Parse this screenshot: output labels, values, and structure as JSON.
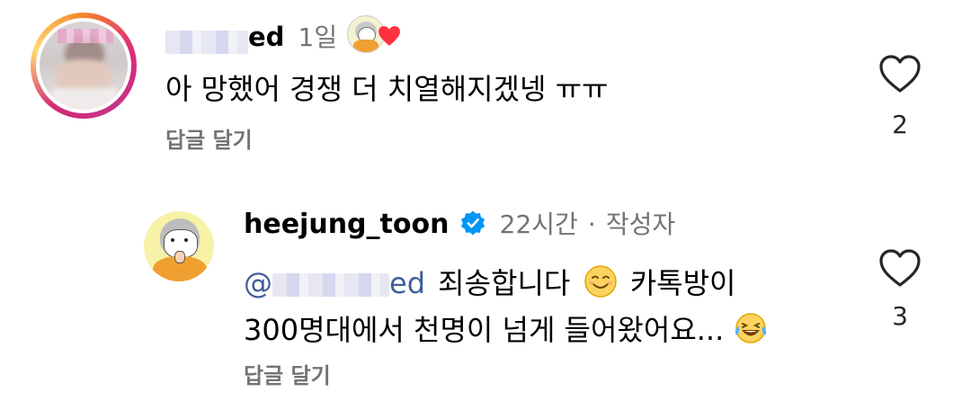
{
  "comments": [
    {
      "username_visible": "ed",
      "time": "1일",
      "text": "아 망했어 경쟁 더 치열해지겠넹 ㅠㅠ",
      "reply_label": "답글 달기",
      "like_count": "2",
      "icons": [
        "creator-liked-badge",
        "heart-outline-icon"
      ]
    },
    {
      "username": "heejung_toon",
      "time": "22시간",
      "separator": "·",
      "author_tag": "작성자",
      "mention_visible": "ed",
      "text_line1": "죄송합니다",
      "text_line1b": "카톡방이",
      "text_line2": "300명대에서 천명이 넘게 들어왔어요...",
      "reply_label": "답글 달기",
      "like_count": "3",
      "icons": [
        "verified-badge-icon",
        "smile-emoji-icon",
        "laugh-cry-emoji-icon",
        "heart-outline-icon"
      ]
    }
  ],
  "colors": {
    "accent_blue": "#0095f6",
    "mention": "#3f5e9a",
    "muted": "#737373",
    "heart_red": "#ff3040"
  }
}
